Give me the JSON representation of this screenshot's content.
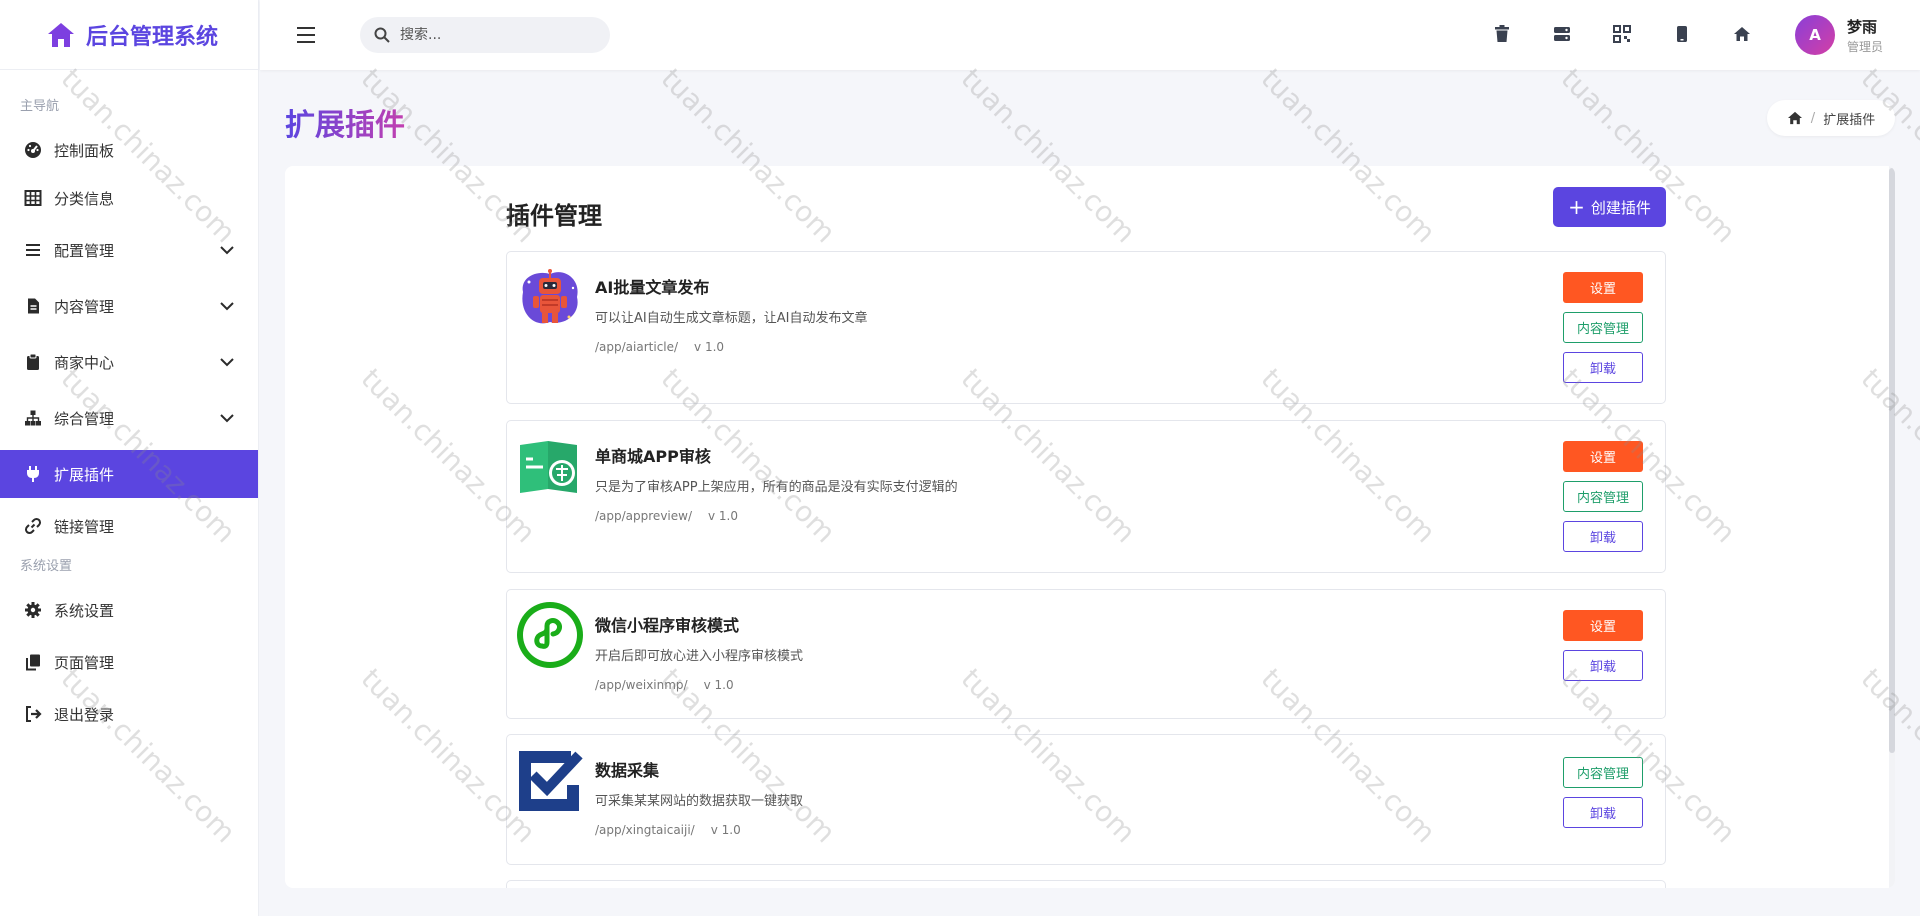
{
  "brand": {
    "title": "后台管理系统"
  },
  "sidebar": {
    "section_main": "主导航",
    "section_system": "系统设置",
    "items": [
      {
        "label": "控制面板"
      },
      {
        "label": "分类信息"
      },
      {
        "label": "配置管理"
      },
      {
        "label": "内容管理"
      },
      {
        "label": "商家中心"
      },
      {
        "label": "综合管理"
      },
      {
        "label": "扩展插件"
      },
      {
        "label": "链接管理"
      }
    ],
    "system_items": [
      {
        "label": "系统设置"
      },
      {
        "label": "页面管理"
      },
      {
        "label": "退出登录"
      }
    ]
  },
  "topbar": {
    "search_placeholder": "搜索...",
    "user": {
      "avatar_letter": "A",
      "name": "梦雨",
      "role": "管理员"
    }
  },
  "page": {
    "title": "扩展插件",
    "breadcrumb": "扩展插件"
  },
  "panel": {
    "title": "插件管理",
    "create_label": "创建插件"
  },
  "buttons": {
    "settings": "设置",
    "content": "内容管理",
    "uninstall": "卸载"
  },
  "plugins": [
    {
      "name": "AI批量文章发布",
      "desc": "可以让AI自动生成文章标题，让AI自动发布文章",
      "path": "/app/aiarticle/",
      "version": "v 1.0"
    },
    {
      "name": "单商城APP审核",
      "desc": "只是为了审核APP上架应用，所有的商品是没有实际支付逻辑的",
      "path": "/app/appreview/",
      "version": "v 1.0"
    },
    {
      "name": "微信小程序审核模式",
      "desc": "开启后即可放心进入小程序审核模式",
      "path": "/app/weixinmp/",
      "version": "v 1.0"
    },
    {
      "name": "数据采集",
      "desc": "可采集某某网站的数据获取一键获取",
      "path": "/app/xingtaicaiji/",
      "version": "v 1.0"
    }
  ],
  "watermark": "tuan.chinaz.com",
  "colors": {
    "accent": "#5b45e0",
    "danger": "#ff5722",
    "success": "#1e9e6a"
  }
}
